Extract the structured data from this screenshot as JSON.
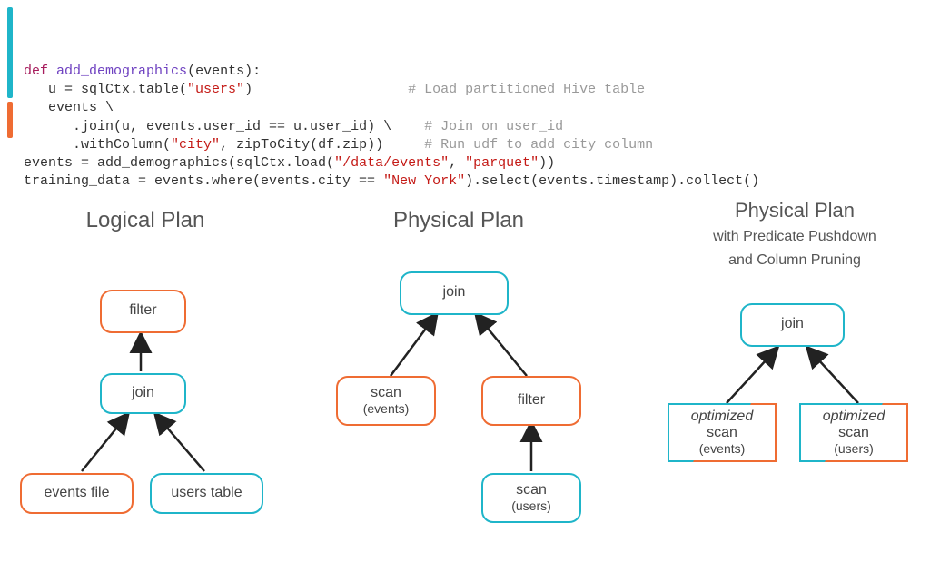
{
  "code": {
    "def": "def",
    "funcname": "add_demographics",
    "param": "events",
    "line1_assign": "u = sqlCtx.table(",
    "line1_str": "\"users\"",
    "line1_close": ")",
    "line1_cmt": "# Load partitioned Hive table",
    "line2": "events \\",
    "line3_a": ".join(u, events.user_id == u.user_id) \\",
    "line3_cmt": "# Join on user_id",
    "line4_a": ".withColumn(",
    "line4_s1": "\"city\"",
    "line4_mid": ", zipToCity(df.zip))",
    "line4_cmt": "# Run udf to add city column",
    "line5_a": "events = add_demographics(sqlCtx.load(",
    "line5_s1": "\"/data/events\"",
    "line5_mid": ", ",
    "line5_s2": "\"parquet\"",
    "line5_close": "))",
    "line6_a": "training_data = events.where(events.city == ",
    "line6_s1": "\"New York\"",
    "line6_b": ").select(events.timestamp).collect()"
  },
  "diagram": {
    "logical": {
      "title": "Logical Plan",
      "filter": "filter",
      "join": "join",
      "events_file": "events file",
      "users_table": "users table"
    },
    "physical": {
      "title": "Physical Plan",
      "join": "join",
      "scan_events_a": "scan",
      "scan_events_b": "(events)",
      "filter": "filter",
      "scan_users_a": "scan",
      "scan_users_b": "(users)"
    },
    "optimized": {
      "title": "Physical Plan",
      "subtitle1": "with Predicate Pushdown",
      "subtitle2": "and Column Pruning",
      "join": "join",
      "opt": "optimized",
      "scan": "scan",
      "events": "(events)",
      "users": "(users)"
    }
  }
}
